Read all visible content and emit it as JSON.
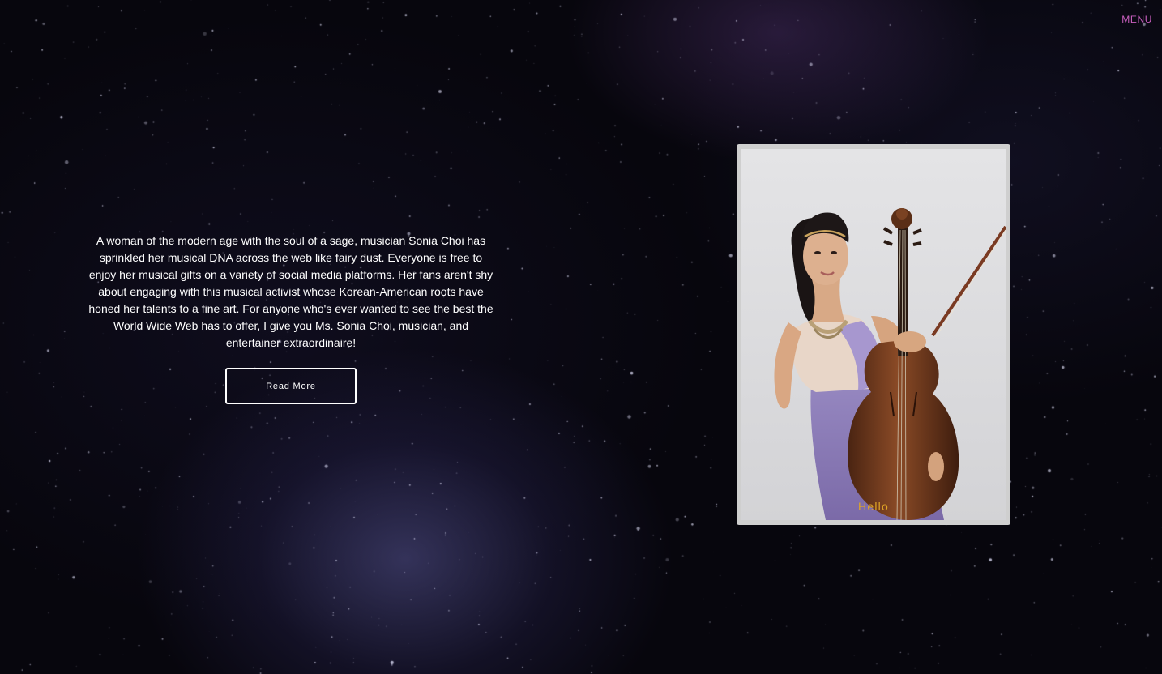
{
  "nav": {
    "menu_label": "MENU"
  },
  "intro": {
    "text": "A woman of the modern age with the soul of a sage, musician Sonia Choi has sprinkled her musical DNA across the web like fairy dust. Everyone is free to enjoy her musical gifts on a variety of social media platforms. Her fans aren't shy about engaging with this musical activist whose Korean-American roots have honed her talents to a fine art. For anyone who's ever wanted to see the best the World Wide Web has to offer, I give you Ms. Sonia Choi, musician, and entertainer extraordinaire!",
    "button_label": "Read More"
  },
  "photo": {
    "caption": "Hello"
  },
  "colors": {
    "menu": "#c95fbf",
    "caption": "#e0a526",
    "background": "#07060d"
  }
}
